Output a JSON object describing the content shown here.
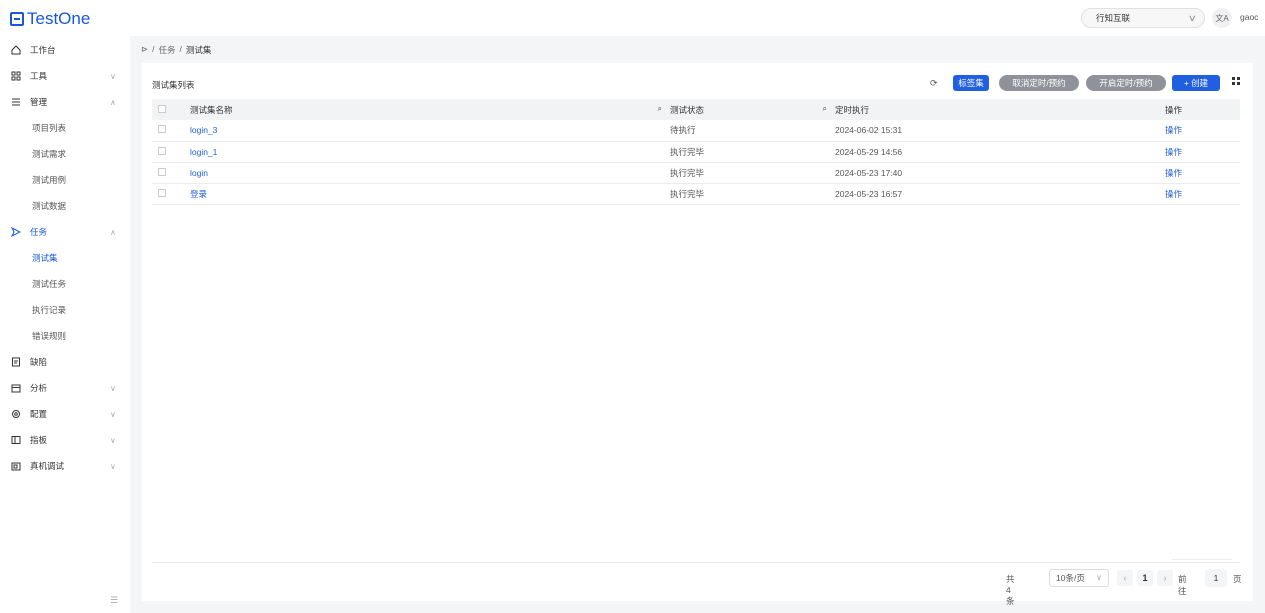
{
  "app": {
    "logo_text": "TestOne"
  },
  "header": {
    "org_select": "行知互联",
    "lang_icon": "translate-icon",
    "user_name": "gaoc"
  },
  "sidebar": {
    "items": [
      {
        "label": "工作台",
        "icon": "home-icon"
      },
      {
        "label": "工具",
        "icon": "grid-icon"
      },
      {
        "label": "管理",
        "icon": "list-icon"
      },
      {
        "label": "项目列表"
      },
      {
        "label": "测试需求"
      },
      {
        "label": "测试用例"
      },
      {
        "label": "测试数据"
      },
      {
        "label": "任务",
        "icon": "send-icon"
      },
      {
        "label": "测试集"
      },
      {
        "label": "测试任务"
      },
      {
        "label": "执行记录"
      },
      {
        "label": "错误规则"
      },
      {
        "label": "缺陷",
        "icon": "bug-icon"
      },
      {
        "label": "分析",
        "icon": "calendar-icon"
      },
      {
        "label": "配置",
        "icon": "settings-icon"
      },
      {
        "label": "指板",
        "icon": "panel-icon"
      },
      {
        "label": "真机调试",
        "icon": "device-icon"
      }
    ]
  },
  "breadcrumb": {
    "home_icon": "send-icon",
    "sep": "/",
    "level1": "任务",
    "level2": "测试集"
  },
  "card": {
    "title": "测试集列表",
    "buttons": {
      "tag": "标签集",
      "cancel": "取消定时/预约",
      "open": "开启定时/预约",
      "create": "+ 创建"
    }
  },
  "table": {
    "headers": {
      "name": "测试集名称",
      "status": "测试状态",
      "time": "定时执行",
      "op": "操作"
    },
    "rows": [
      {
        "name": "login_3",
        "status": "待执行",
        "time": "2024-06-02 15:31",
        "op": "操作"
      },
      {
        "name": "login_1",
        "status": "执行完毕",
        "time": "2024-05-29 14:56",
        "op": "操作"
      },
      {
        "name": "login",
        "status": "执行完毕",
        "time": "2024-05-23 17:40",
        "op": "操作"
      },
      {
        "name": "登录",
        "status": "执行完毕",
        "time": "2024-05-23 16:57",
        "op": "操作"
      }
    ]
  },
  "pagination": {
    "total": "共 4 条",
    "page_size": "10条/页",
    "current_page": "1",
    "jump_label": "前往",
    "jump_value": "1",
    "unit": "页"
  }
}
